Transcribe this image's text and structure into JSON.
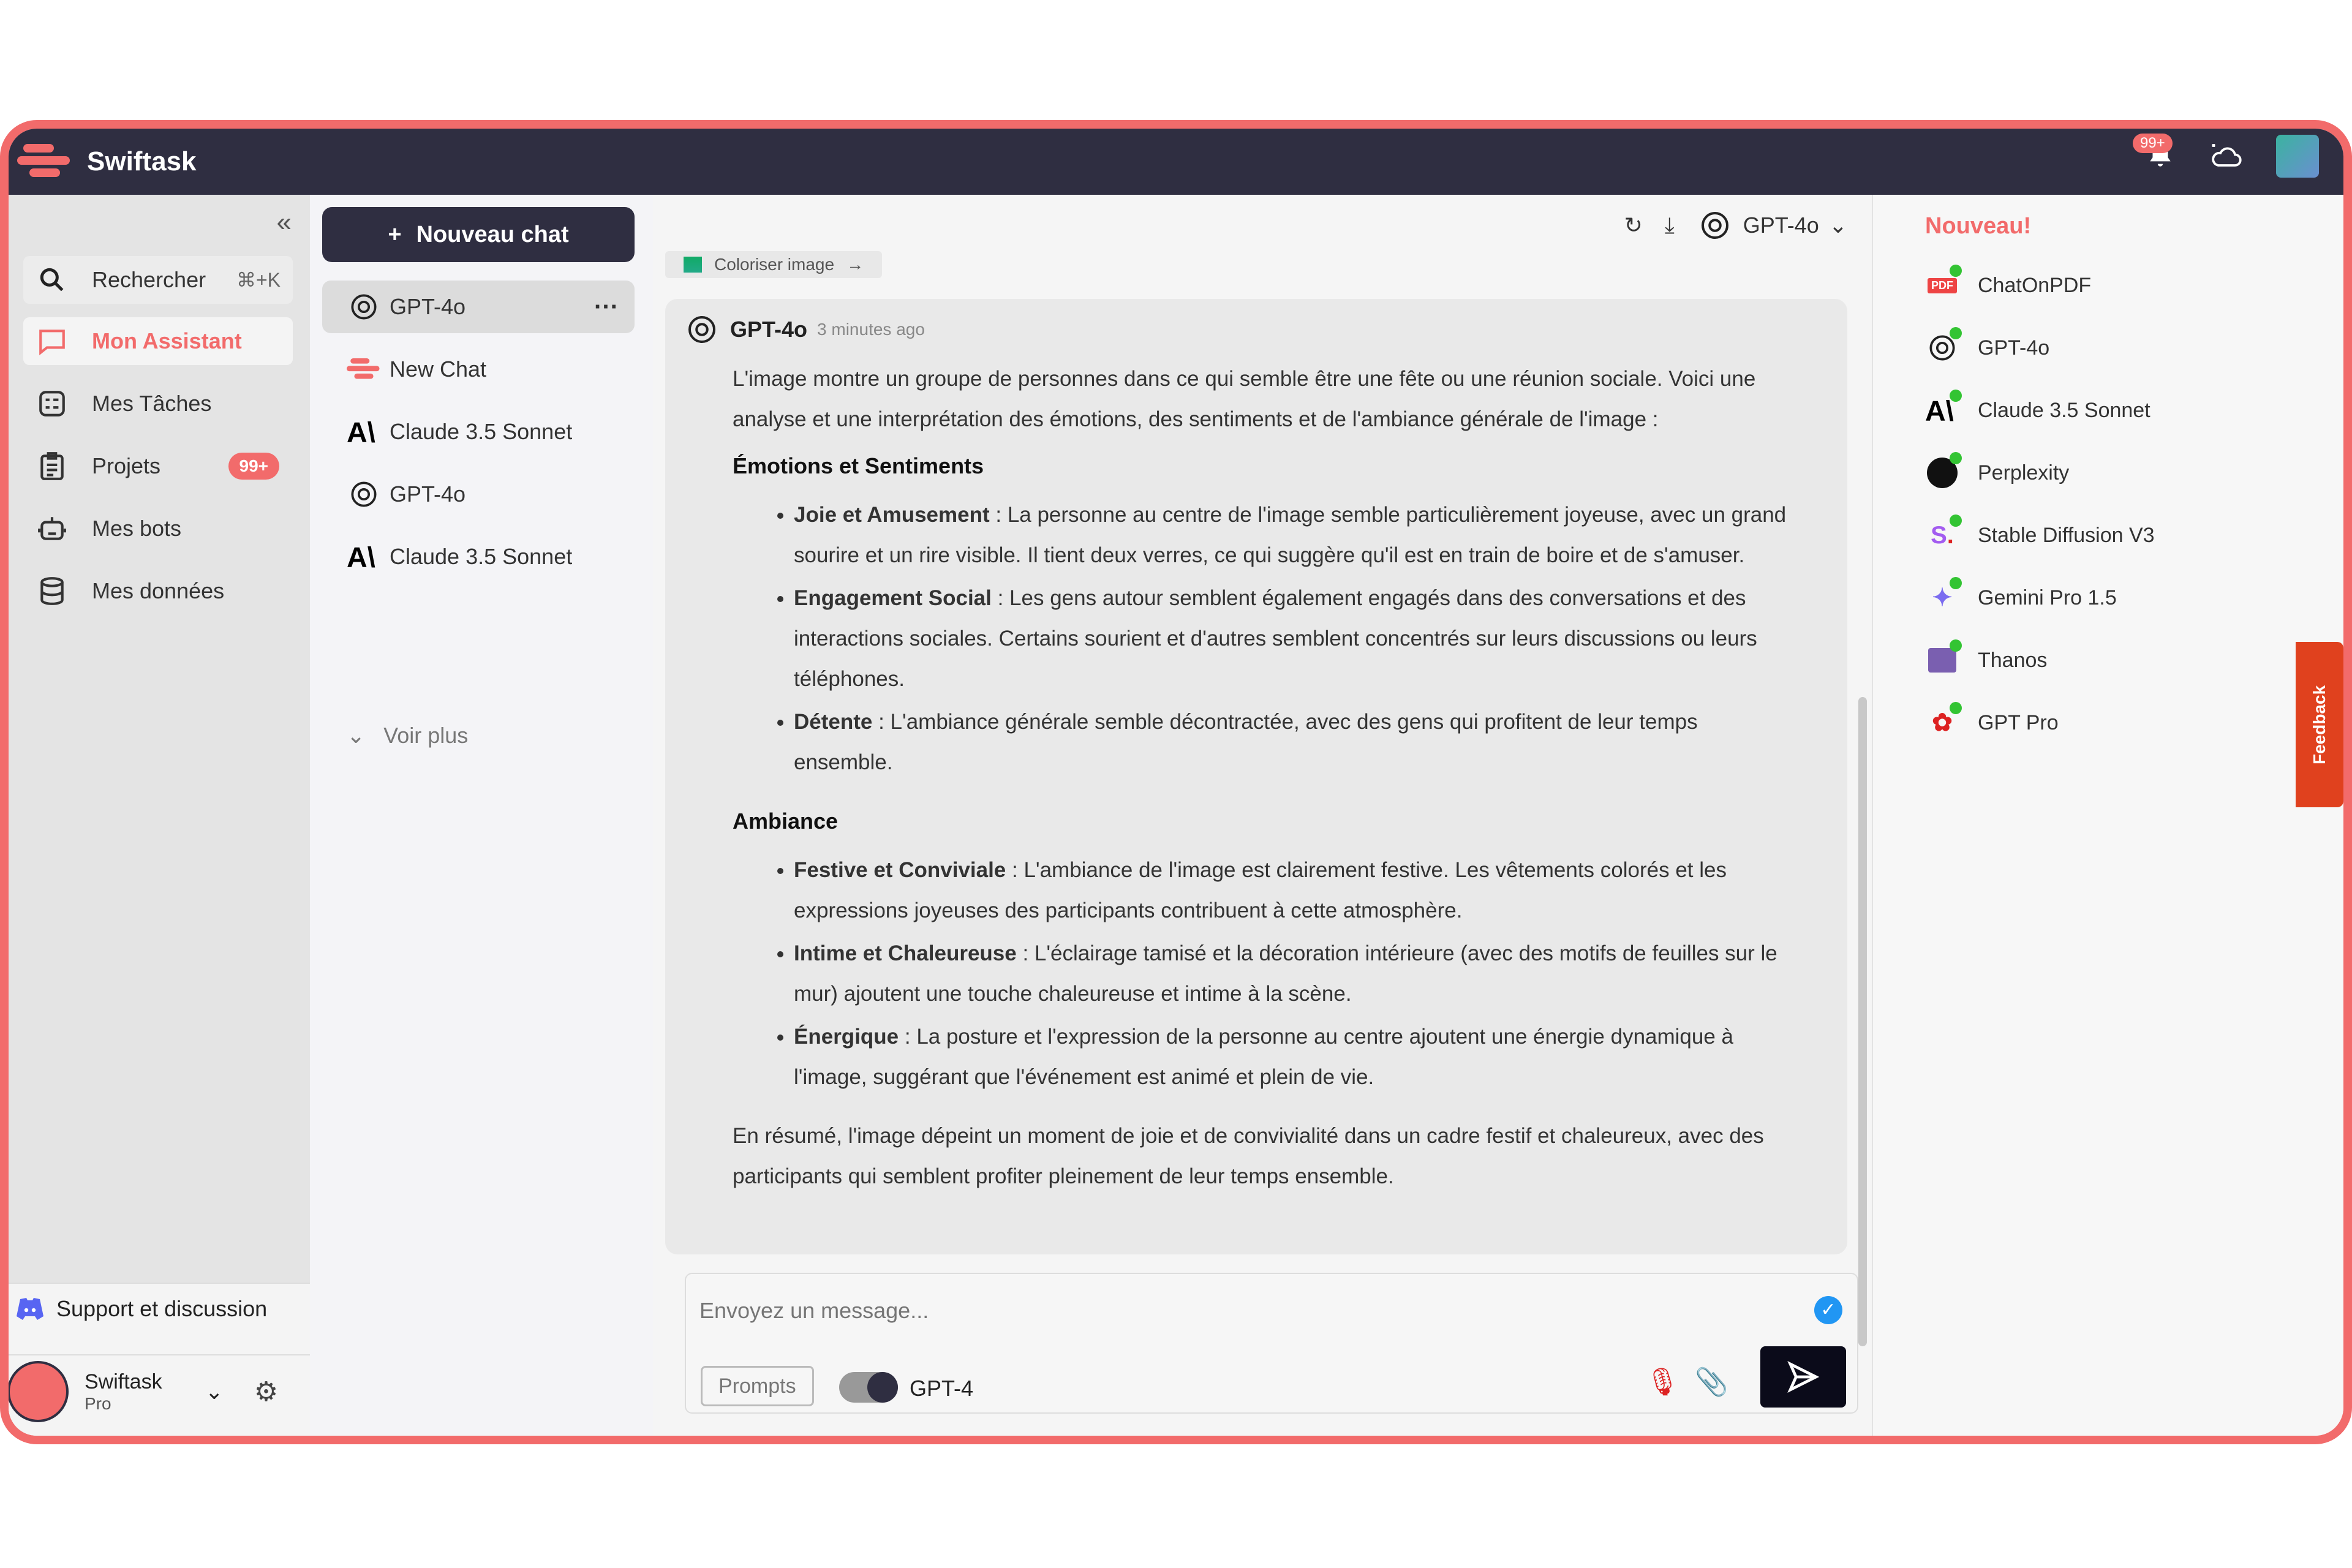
{
  "app": {
    "title": "Swiftask",
    "notification_count": "99+",
    "brand_color": "#f26b6b",
    "header_color": "#2f2e41"
  },
  "sidebar": {
    "search": {
      "label": "Rechercher",
      "shortcut": "⌘+K"
    },
    "items": [
      {
        "label": "Mon Assistant",
        "icon": "chat-bubble-icon",
        "active": true
      },
      {
        "label": "Mes Tâches",
        "icon": "tasks-icon"
      },
      {
        "label": "Projets",
        "icon": "clipboard-icon",
        "badge": "99+"
      },
      {
        "label": "Mes bots",
        "icon": "robot-icon"
      },
      {
        "label": "Mes données",
        "icon": "database-icon"
      }
    ],
    "support": "Support et discussion",
    "user": {
      "name": "Swiftask",
      "plan": "Pro"
    }
  },
  "chatlist": {
    "new_chat": "Nouveau chat",
    "items": [
      {
        "label": "GPT-4o",
        "icon": "openai-icon",
        "selected": true
      },
      {
        "label": "New Chat",
        "icon": "swiftask-icon"
      },
      {
        "label": "Claude 3.5 Sonnet",
        "icon": "anthropic-icon"
      },
      {
        "label": "GPT-4o",
        "icon": "openai-icon"
      },
      {
        "label": "Claude 3.5 Sonnet",
        "icon": "anthropic-icon"
      }
    ],
    "see_more": "Voir plus"
  },
  "main": {
    "model_selector": "GPT-4o",
    "chip": "Coloriser image",
    "message": {
      "author": "GPT-4o",
      "time": "3 minutes ago",
      "intro": "L'image montre un groupe de personnes dans ce qui semble être une fête ou une réunion sociale. Voici une analyse et une interprétation des émotions, des sentiments et de l'ambiance générale de l'image :",
      "sections": [
        {
          "title": "Émotions et Sentiments",
          "bullets": [
            {
              "term": "Joie et Amusement",
              "text": " : La personne au centre de l'image semble particulièrement joyeuse, avec un grand sourire et un rire visible. Il tient deux verres, ce qui suggère qu'il est en train de boire et de s'amuser."
            },
            {
              "term": "Engagement Social",
              "text": " : Les gens autour semblent également engagés dans des conversations et des interactions sociales. Certains sourient et d'autres semblent concentrés sur leurs discussions ou leurs téléphones."
            },
            {
              "term": "Détente",
              "text": " : L'ambiance générale semble décontractée, avec des gens qui profitent de leur temps ensemble."
            }
          ]
        },
        {
          "title": "Ambiance",
          "bullets": [
            {
              "term": "Festive et Conviviale",
              "text": " : L'ambiance de l'image est clairement festive. Les vêtements colorés et les expressions joyeuses des participants contribuent à cette atmosphère."
            },
            {
              "term": "Intime et Chaleureuse",
              "text": " : L'éclairage tamisé et la décoration intérieure (avec des motifs de feuilles sur le mur) ajoutent une touche chaleureuse et intime à la scène."
            },
            {
              "term": "Énergique",
              "text": " : La posture et l'expression de la personne au centre ajoutent une énergie dynamique à l'image, suggérant que l'événement est animé et plein de vie."
            }
          ]
        }
      ],
      "summary": "En résumé, l'image dépeint un moment de joie et de convivialité dans un cadre festif et chaleureux, avec des participants qui semblent profiter pleinement de leur temps ensemble."
    },
    "input": {
      "placeholder": "Envoyez un message...",
      "value": "",
      "prompts": "Prompts",
      "toggle_on": true,
      "model": "GPT-4"
    }
  },
  "right": {
    "title": "Nouveau!",
    "items": [
      "ChatOnPDF",
      "GPT-4o",
      "Claude 3.5 Sonnet",
      "Perplexity",
      "Stable Diffusion V3",
      "Gemini Pro 1.5",
      "Thanos",
      "GPT Pro"
    ],
    "feedback": "Feedback"
  }
}
